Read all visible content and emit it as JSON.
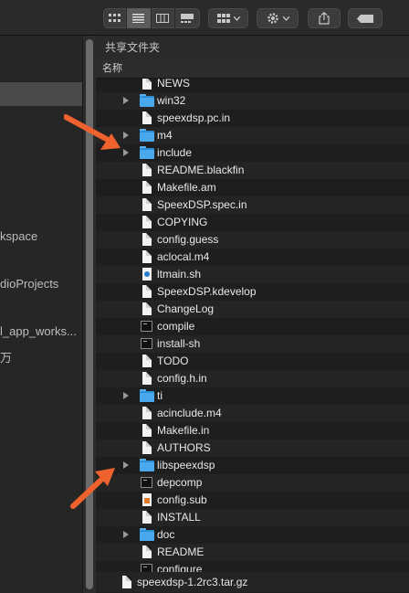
{
  "toolbar": {
    "view_modes": [
      "icon-view",
      "list-view",
      "column-view",
      "gallery-view"
    ],
    "active_view": "list-view",
    "group_icon": "grid-icon",
    "action_icon": "gear-icon",
    "share_icon": "share-icon",
    "tag_icon": "tag-icon"
  },
  "sidebar": {
    "items": [
      {
        "label": "kspace"
      },
      {
        "label": "dioProjects"
      },
      {
        "label": "l_app_works..."
      },
      {
        "label": "万"
      }
    ]
  },
  "main": {
    "path_title": "共享文件夹",
    "column_header": "名称",
    "files": [
      {
        "name": "NEWS",
        "type": "doc",
        "expandable": false
      },
      {
        "name": "win32",
        "type": "folder",
        "expandable": true
      },
      {
        "name": "speexdsp.pc.in",
        "type": "doc",
        "expandable": false
      },
      {
        "name": "m4",
        "type": "folder",
        "expandable": true
      },
      {
        "name": "include",
        "type": "folder",
        "expandable": true
      },
      {
        "name": "README.blackfin",
        "type": "doc",
        "expandable": false
      },
      {
        "name": "Makefile.am",
        "type": "doc",
        "expandable": false
      },
      {
        "name": "SpeexDSP.spec.in",
        "type": "doc",
        "expandable": false
      },
      {
        "name": "COPYING",
        "type": "doc",
        "expandable": false
      },
      {
        "name": "config.guess",
        "type": "doc",
        "expandable": false
      },
      {
        "name": "aclocal.m4",
        "type": "doc",
        "expandable": false
      },
      {
        "name": "ltmain.sh",
        "type": "shell",
        "expandable": false
      },
      {
        "name": "SpeexDSP.kdevelop",
        "type": "doc",
        "expandable": false
      },
      {
        "name": "ChangeLog",
        "type": "doc",
        "expandable": false
      },
      {
        "name": "compile",
        "type": "exec",
        "expandable": false
      },
      {
        "name": "install-sh",
        "type": "exec",
        "expandable": false
      },
      {
        "name": "TODO",
        "type": "doc",
        "expandable": false
      },
      {
        "name": "config.h.in",
        "type": "doc",
        "expandable": false
      },
      {
        "name": "ti",
        "type": "folder",
        "expandable": true
      },
      {
        "name": "acinclude.m4",
        "type": "doc",
        "expandable": false
      },
      {
        "name": "Makefile.in",
        "type": "doc",
        "expandable": false
      },
      {
        "name": "AUTHORS",
        "type": "doc",
        "expandable": false
      },
      {
        "name": "libspeexdsp",
        "type": "folder",
        "expandable": true
      },
      {
        "name": "depcomp",
        "type": "exec",
        "expandable": false
      },
      {
        "name": "config.sub",
        "type": "sub",
        "expandable": false
      },
      {
        "name": "INSTALL",
        "type": "doc",
        "expandable": false
      },
      {
        "name": "doc",
        "type": "folder",
        "expandable": true
      },
      {
        "name": "README",
        "type": "doc",
        "expandable": false
      },
      {
        "name": "configure",
        "type": "exec",
        "expandable": false
      }
    ],
    "bottom_file": {
      "name": "speexdsp-1.2rc3.tar.gz",
      "type": "doc"
    }
  },
  "annotations": {
    "arrow_color": "#f0622d"
  }
}
